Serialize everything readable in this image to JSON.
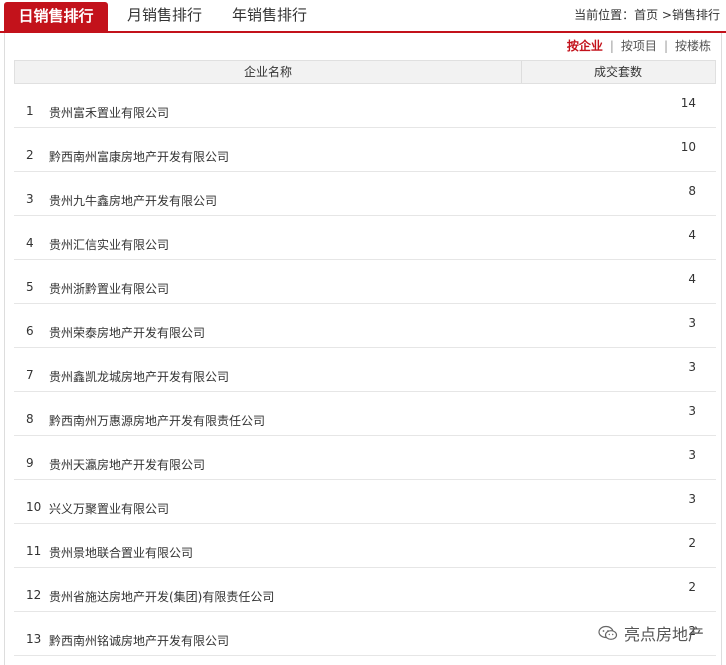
{
  "tabs": [
    {
      "label": "日销售排行",
      "active": true
    },
    {
      "label": "月销售排行",
      "active": false
    },
    {
      "label": "年销售排行",
      "active": false
    }
  ],
  "breadcrumb": {
    "prefix": "当前位置：",
    "home": "首页",
    "separator": " >",
    "current": "销售排行"
  },
  "filters": [
    {
      "label": "按企业",
      "active": true
    },
    {
      "label": "按项目",
      "active": false
    },
    {
      "label": "按楼栋",
      "active": false
    }
  ],
  "table": {
    "headers": [
      "企业名称",
      "成交套数"
    ],
    "rows": [
      {
        "rank": "1",
        "name": "贵州富禾置业有限公司",
        "count": "14"
      },
      {
        "rank": "2",
        "name": "黔西南州富康房地产开发有限公司",
        "count": "10"
      },
      {
        "rank": "3",
        "name": "贵州九牛鑫房地产开发有限公司",
        "count": "8"
      },
      {
        "rank": "4",
        "name": "贵州汇信实业有限公司",
        "count": "4"
      },
      {
        "rank": "5",
        "name": "贵州浙黔置业有限公司",
        "count": "4"
      },
      {
        "rank": "6",
        "name": "贵州荣泰房地产开发有限公司",
        "count": "3"
      },
      {
        "rank": "7",
        "name": "贵州鑫凯龙城房地产开发有限公司",
        "count": "3"
      },
      {
        "rank": "8",
        "name": "黔西南州万惠源房地产开发有限责任公司",
        "count": "3"
      },
      {
        "rank": "9",
        "name": "贵州天瀛房地产开发有限公司",
        "count": "3"
      },
      {
        "rank": "10",
        "name": "兴义万聚置业有限公司",
        "count": "3"
      },
      {
        "rank": "11",
        "name": "贵州景地联合置业有限公司",
        "count": "2"
      },
      {
        "rank": "12",
        "name": "贵州省施达房地产开发(集团)有限责任公司",
        "count": "2"
      },
      {
        "rank": "13",
        "name": "黔西南州铭诚房地产开发有限公司",
        "count": "2"
      }
    ]
  },
  "watermark": {
    "text": "亮点房地产",
    "icon": "wechat-icon"
  },
  "colors": {
    "accent": "#c3121b",
    "header_bg": "#f2f2f2",
    "row_border": "#e6e6e6"
  }
}
